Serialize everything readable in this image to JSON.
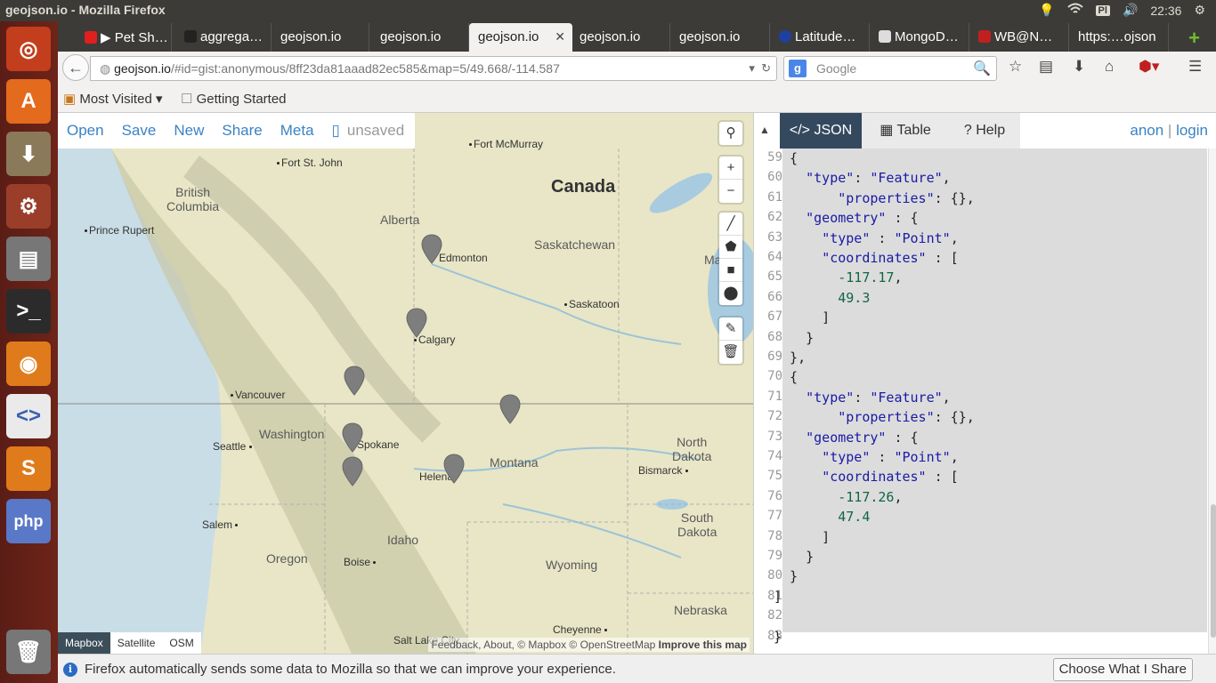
{
  "window": {
    "title": "geojson.io - Mozilla Firefox"
  },
  "system_tray": {
    "keyboard": "Pl",
    "time": "22:36"
  },
  "tabs": [
    {
      "label": "▶ Pet Sh…",
      "icon_color": "#e02020"
    },
    {
      "label": "aggrega…",
      "icon_color": "#222222"
    },
    {
      "label": "geojson.io"
    },
    {
      "label": "geojson.io"
    },
    {
      "label": "geojson.io",
      "active": true
    },
    {
      "label": "geojson.io"
    },
    {
      "label": "geojson.io"
    },
    {
      "label": "Latitude…",
      "icon_color": "#2040a0"
    },
    {
      "label": "MongoD…",
      "icon_color": "#dddddd"
    },
    {
      "label": "WB@N…",
      "icon_color": "#c02020"
    },
    {
      "label": "https:…ojson"
    }
  ],
  "navbar": {
    "url_host": "geojson.io",
    "url_rest": "/#id=gist:anonymous/8ff23da81aaad82ec585&map=5/49.668/-114.587",
    "search_placeholder": "Google"
  },
  "bookmarks": {
    "most_visited": "Most Visited ▾",
    "getting_started": "Getting Started"
  },
  "map_toolbar": {
    "open": "Open",
    "save": "Save",
    "new": "New",
    "share": "Share",
    "meta": "Meta",
    "status": "unsaved"
  },
  "map": {
    "labels": [
      {
        "text": "Canada",
        "kind": "country"
      },
      {
        "text": "British\nColumbia",
        "kind": "region"
      },
      {
        "text": "Alberta",
        "kind": "region"
      },
      {
        "text": "Saskatchewan",
        "kind": "region"
      },
      {
        "text": "Washington",
        "kind": "region"
      },
      {
        "text": "Montana",
        "kind": "region"
      },
      {
        "text": "Idaho",
        "kind": "region"
      },
      {
        "text": "Oregon",
        "kind": "region"
      },
      {
        "text": "Wyoming",
        "kind": "region"
      },
      {
        "text": "North\nDakota",
        "kind": "region"
      },
      {
        "text": "South\nDakota",
        "kind": "region"
      },
      {
        "text": "Nebraska",
        "kind": "region"
      },
      {
        "text": "Fort McMurray",
        "kind": "city"
      },
      {
        "text": "Fort St. John",
        "kind": "city"
      },
      {
        "text": "Prince Rupert",
        "kind": "city"
      },
      {
        "text": "Edmonton",
        "kind": "city"
      },
      {
        "text": "Calgary",
        "kind": "city"
      },
      {
        "text": "Saskatoon",
        "kind": "city"
      },
      {
        "text": "Vancouver",
        "kind": "city"
      },
      {
        "text": "Seattle",
        "kind": "city"
      },
      {
        "text": "Spokane",
        "kind": "city"
      },
      {
        "text": "Helena",
        "kind": "city"
      },
      {
        "text": "Bismarck",
        "kind": "city"
      },
      {
        "text": "Salem",
        "kind": "city"
      },
      {
        "text": "Boise",
        "kind": "city"
      },
      {
        "text": "Cheyenne",
        "kind": "city"
      },
      {
        "text": "Salt Lake City",
        "kind": "city"
      },
      {
        "text": "Ma",
        "kind": "region"
      }
    ],
    "layers": [
      "Mapbox",
      "Satellite",
      "OSM"
    ],
    "attribution": "Feedback, About, © Mapbox © OpenStreetMap",
    "attribution_link": "Improve this map"
  },
  "panel": {
    "tabs": {
      "json": "JSON",
      "table": "Table",
      "help": "Help"
    },
    "anon": "anon",
    "sep": "|",
    "login": "login"
  },
  "editor": {
    "lines": [
      {
        "n": "59",
        "text": "  {"
      },
      {
        "n": "60",
        "text": "    \"type\": \"Feature\","
      },
      {
        "n": "61",
        "text": "        \"properties\": {},"
      },
      {
        "n": "62",
        "text": "    \"geometry\" : {"
      },
      {
        "n": "63",
        "text": "      \"type\" : \"Point\","
      },
      {
        "n": "64",
        "text": "      \"coordinates\" : ["
      },
      {
        "n": "65",
        "text": "        -117.17,"
      },
      {
        "n": "66",
        "text": "        49.3"
      },
      {
        "n": "67",
        "text": "      ]"
      },
      {
        "n": "68",
        "text": "    }"
      },
      {
        "n": "69",
        "text": "  },"
      },
      {
        "n": "70",
        "text": "  {"
      },
      {
        "n": "71",
        "text": "    \"type\": \"Feature\","
      },
      {
        "n": "72",
        "text": "        \"properties\": {},"
      },
      {
        "n": "73",
        "text": "    \"geometry\" : {"
      },
      {
        "n": "74",
        "text": "      \"type\" : \"Point\","
      },
      {
        "n": "75",
        "text": "      \"coordinates\" : ["
      },
      {
        "n": "76",
        "text": "        -117.26,"
      },
      {
        "n": "77",
        "text": "        47.4"
      },
      {
        "n": "78",
        "text": "      ]"
      },
      {
        "n": "79",
        "text": "    }"
      },
      {
        "n": "80",
        "text": "  }"
      },
      {
        "n": "81",
        "text": "]"
      },
      {
        "n": "82",
        "text": ""
      },
      {
        "n": "83",
        "text": "}"
      }
    ]
  },
  "notification": {
    "message": "Firefox automatically sends some data to Mozilla so that we can improve your experience.",
    "button": "Choose What I Share"
  },
  "colors": {
    "accent": "#3b82c4",
    "panel_tab": "#34495e",
    "map_bg": "#e8e6c6"
  }
}
